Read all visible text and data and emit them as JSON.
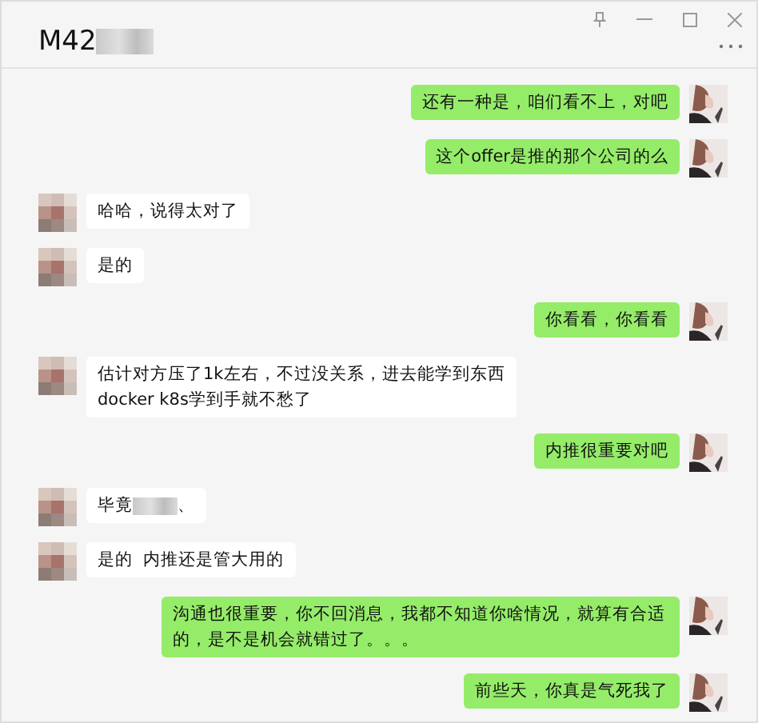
{
  "window": {
    "title": "M42",
    "title_redacted": true
  },
  "messages": [
    {
      "outgoing": true,
      "text": "还有一种是，咱们看不上，对吧"
    },
    {
      "outgoing": true,
      "text": "这个offer是推的那个公司的么"
    },
    {
      "outgoing": false,
      "text": "哈哈，说得太对了"
    },
    {
      "outgoing": false,
      "text": "是的"
    },
    {
      "outgoing": true,
      "text": "你看看，你看看"
    },
    {
      "outgoing": false,
      "text": "估计对方压了1k左右，不过没关系，进去能学到东西\ndocker k8s学到手就不愁了"
    },
    {
      "outgoing": true,
      "text": "内推很重要对吧"
    },
    {
      "outgoing": false,
      "text": "毕竟",
      "redacted": true,
      "tail": "、"
    },
    {
      "outgoing": false,
      "text": "是的  内推还是管大用的"
    },
    {
      "outgoing": true,
      "text": "沟通也很重要，你不回消息，我都不知道你啥情况，就算有合适的，是不是机会就错过了。。。"
    },
    {
      "outgoing": true,
      "text": "前些天，你真是气死我了"
    }
  ]
}
